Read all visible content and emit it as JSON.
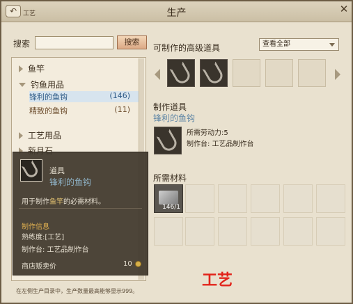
{
  "window": {
    "title": "生产",
    "back_label": "工艺",
    "close": "✕"
  },
  "search": {
    "label": "搜索",
    "button": "搜索"
  },
  "categories": {
    "fishing_rod": "鱼竿",
    "fishing_supplies": "钓鱼用品",
    "items": [
      {
        "label": "锋利的鱼钩",
        "count": "(146)"
      },
      {
        "label": "精致的鱼钩",
        "count": "(11)"
      }
    ],
    "craft_supplies": "工艺用品",
    "partial": "新月石"
  },
  "tooltip": {
    "type": "道具",
    "name": "锋利的鱼钩",
    "desc_prefix": "用于制作",
    "desc_highlight": "鱼竿",
    "desc_suffix": "的必需材料。",
    "craft_info": "制作信息",
    "skill": "熟练度:[工艺]",
    "station": "制作台: 工艺品制作台",
    "shop_price_label": "商店贩卖价",
    "shop_price": "10"
  },
  "advanced": {
    "title": "可制作的高级道具",
    "filter": "查看全部"
  },
  "make": {
    "title": "制作道具",
    "name": "锋利的鱼钩",
    "labor": "所需劳动力:5",
    "station": "制作台: 工艺品制作台"
  },
  "materials": {
    "title": "所需材料",
    "first_count": "146/1"
  },
  "footer": "在左侧生产目录中，生产数量最高能够显示999。",
  "overlay": "工艺",
  "colors": {
    "accent": "#e2231a",
    "selected": "#2e5a86"
  }
}
